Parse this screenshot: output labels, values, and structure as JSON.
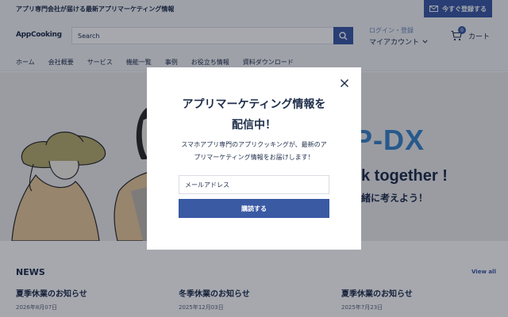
{
  "topbar": {
    "announcement": "アプリ専門会社が届ける最新アプリマーケティング情報",
    "contact_label": "今すぐ登録する",
    "contact_icon": "mail-icon"
  },
  "header": {
    "logo": "AppCooking",
    "search_placeholder": "Search",
    "account_login": "ログイン・登録",
    "account_label": "マイアカウント",
    "cart_label": "カート",
    "cart_count": "0"
  },
  "nav": {
    "items": [
      "ホーム",
      "会社概要",
      "サービス",
      "機能一覧",
      "事例",
      "お役立ち情報",
      "資料ダウンロード"
    ]
  },
  "hero": {
    "dx_text": "P-DX",
    "together_text": "k together !",
    "jp_text": "緒に考えよう！"
  },
  "news": {
    "title": "NEWS",
    "view_all": "View all",
    "items": [
      {
        "title": "夏季休業のお知らせ",
        "date": "2026年8月07日"
      },
      {
        "title": "冬季休業のお知らせ",
        "date": "2025年12月03日"
      },
      {
        "title": "夏季休業のお知らせ",
        "date": "2025年7月23日"
      }
    ]
  },
  "modal": {
    "title_line1": "アプリマーケティング情報を",
    "title_line2": "配信中！",
    "desc_line1": "スマホアプリ専門のアプリクッキングが、最新のア",
    "desc_line2": "プリマーケティング情報をお届けします！",
    "email_placeholder": "メールアドレス",
    "submit_label": "購読する"
  },
  "colors": {
    "brand": "#3a5aa4",
    "text": "#1e2d4a",
    "accent_blue": "#3a84c9"
  }
}
